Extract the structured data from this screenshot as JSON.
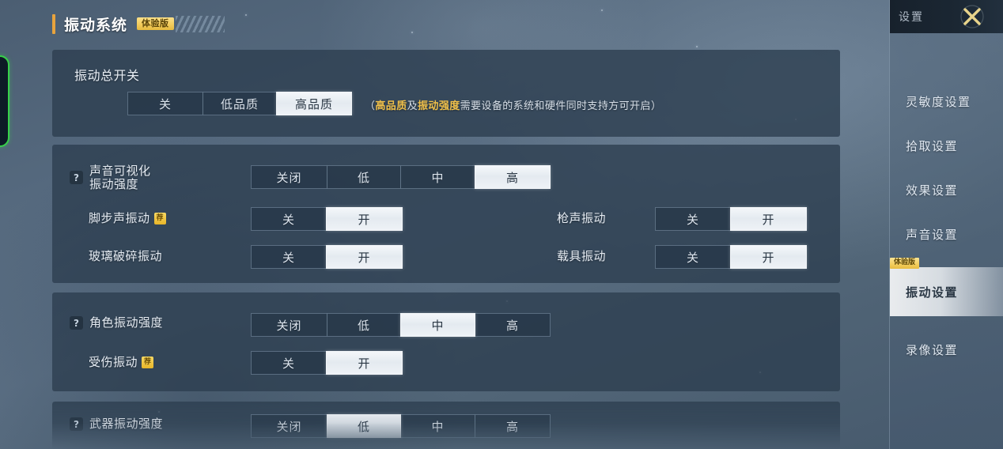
{
  "page": {
    "title": "振动系统",
    "title_badge": "体验版"
  },
  "master": {
    "heading": "振动总开关",
    "options": [
      "关",
      "低品质",
      "高品质"
    ],
    "selected": "高品质",
    "hint_prefix": "（",
    "hint_hl1": "高品质",
    "hint_mid": "及",
    "hint_hl2": "振动强度",
    "hint_suffix": "需要设备的系统和硬件同时支持方可开启）"
  },
  "sound_section": {
    "intensity_row": {
      "help_icon": "?",
      "label": "声音可视化\n振动强度",
      "options": [
        "关闭",
        "低",
        "中",
        "高"
      ],
      "selected": "高"
    },
    "toggles_left": [
      {
        "label": "脚步声振动",
        "badge": "荐",
        "options": [
          "关",
          "开"
        ],
        "selected": "开"
      },
      {
        "label": "玻璃破碎振动",
        "badge": "",
        "options": [
          "关",
          "开"
        ],
        "selected": "开"
      }
    ],
    "toggles_right": [
      {
        "label": "枪声振动",
        "badge": "",
        "options": [
          "关",
          "开"
        ],
        "selected": "开"
      },
      {
        "label": "载具振动",
        "badge": "",
        "options": [
          "关",
          "开"
        ],
        "selected": "开"
      }
    ]
  },
  "character_section": {
    "intensity_row": {
      "help_icon": "?",
      "label": "角色振动强度",
      "options": [
        "关闭",
        "低",
        "中",
        "高"
      ],
      "selected": "中"
    },
    "toggles_left": [
      {
        "label": "受伤振动",
        "badge": "荐",
        "options": [
          "关",
          "开"
        ],
        "selected": "开"
      }
    ]
  },
  "weapon_section": {
    "intensity_row": {
      "help_icon": "?",
      "label": "武器振动强度",
      "options": [
        "关闭",
        "低",
        "中",
        "高"
      ],
      "selected": "低"
    }
  },
  "sidebar": {
    "header_title": "设置",
    "close_icon": "close-x-icon",
    "items": [
      {
        "label": "灵敏度设置",
        "active": false,
        "tag": ""
      },
      {
        "label": "拾取设置",
        "active": false,
        "tag": ""
      },
      {
        "label": "效果设置",
        "active": false,
        "tag": ""
      },
      {
        "label": "声音设置",
        "active": false,
        "tag": ""
      },
      {
        "label": "振动设置",
        "active": true,
        "tag": "体验版"
      },
      {
        "label": "录像设置",
        "active": false,
        "tag": ""
      }
    ]
  },
  "colors": {
    "accent_gold": "#e8a33d",
    "badge_gold": "#f2cd5d",
    "selected_white": "#eef2f6",
    "panel_bg": "#2d3e50",
    "green_highlight": "#37d24a"
  }
}
